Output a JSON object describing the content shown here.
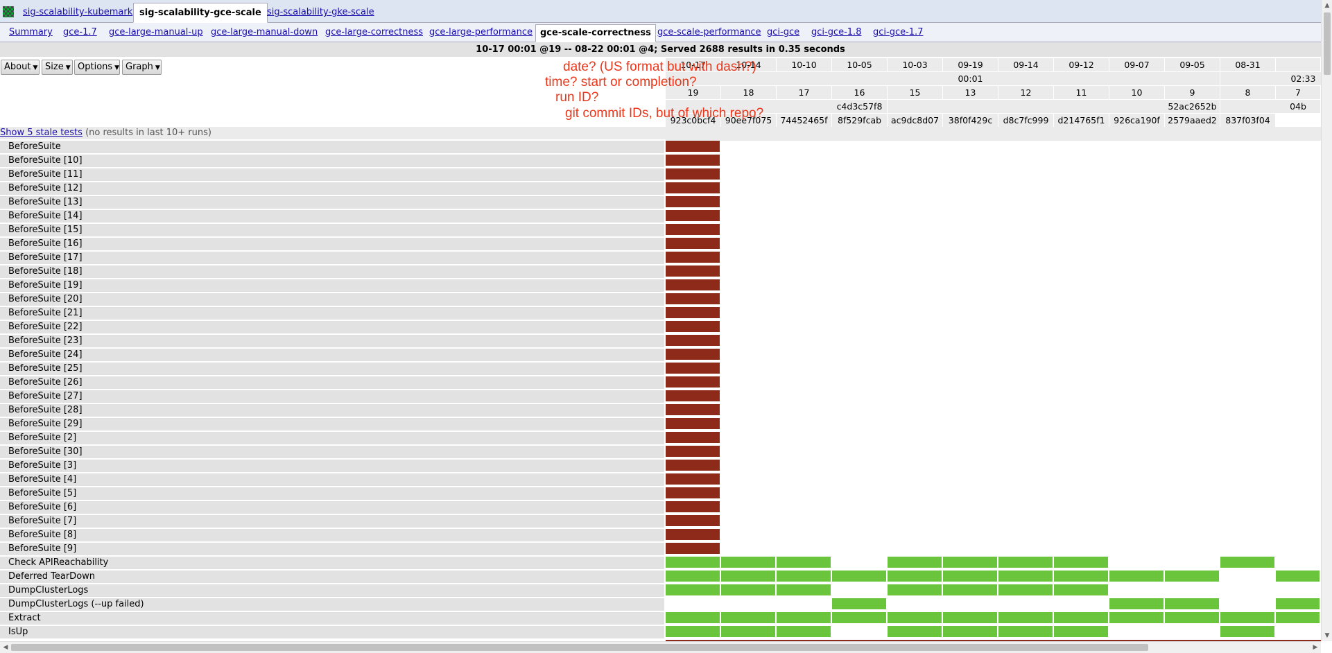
{
  "top_tabs": [
    {
      "label": "sig-scalability-kubemark",
      "active": false
    },
    {
      "label": "sig-scalability-gce-scale",
      "active": true
    },
    {
      "label": "sig-scalability-gke-scale",
      "active": false
    }
  ],
  "sub_tabs": [
    {
      "label": "Summary",
      "active": false
    },
    {
      "label": "gce-1.7",
      "active": false
    },
    {
      "label": "gce-large-manual-up",
      "active": false
    },
    {
      "label": "gce-large-manual-down",
      "active": false
    },
    {
      "label": "gce-large-correctness",
      "active": false
    },
    {
      "label": "gce-large-performance",
      "active": false
    },
    {
      "label": "gce-scale-correctness",
      "active": true
    },
    {
      "label": "gce-scale-performance",
      "active": false
    },
    {
      "label": "gci-gce",
      "active": false
    },
    {
      "label": "gci-gce-1.8",
      "active": false
    },
    {
      "label": "gci-gce-1.7",
      "active": false
    }
  ],
  "status": "10-17 00:01 @19 -- 08-22 00:01 @4; Served 2688 results in 0.35 seconds",
  "menu": {
    "about": "About",
    "size": "Size",
    "options": "Options",
    "graph": "Graph"
  },
  "columns": [
    {
      "date": "10-17",
      "run": "19",
      "commit2": "923c0bcf4"
    },
    {
      "date": "10-14",
      "run": "18",
      "commit2": "90ee7f075"
    },
    {
      "date": "10-10",
      "run": "17",
      "commit2": "74452465f"
    },
    {
      "date": "10-05",
      "run": "16",
      "commit1": "c4d3c57f8",
      "commit2": "8f529fcab"
    },
    {
      "date": "10-03",
      "run": "15",
      "commit2": "ac9dc8d07"
    },
    {
      "date": "09-19",
      "run": "13",
      "commit2": "38f0f429c"
    },
    {
      "date": "09-14",
      "run": "12",
      "commit2": "d8c7fc999"
    },
    {
      "date": "09-12",
      "run": "11",
      "commit2": "d214765f1"
    },
    {
      "date": "09-07",
      "run": "10",
      "commit2": "926ca190f"
    },
    {
      "date": "09-05",
      "run": "9",
      "commit1": "52ac2652b",
      "commit2": "2579aaed2"
    },
    {
      "date": "08-31",
      "run": "8",
      "commit2": "837f03f04"
    },
    {
      "date": "",
      "run": "7",
      "commit1": "04b"
    }
  ],
  "time_labels": {
    "group1": "00:01",
    "group2": "02:33"
  },
  "stale": {
    "link": "Show 5 stale tests",
    "note": "(no results in last 10+ runs)"
  },
  "legend_colors": {
    "fail": "#8e2a19",
    "pass": "#6ac43c",
    "none": "#ffffff"
  },
  "tests": [
    {
      "name": "BeforeSuite",
      "results": "F..........."
    },
    {
      "name": "BeforeSuite [10]",
      "results": "F..........."
    },
    {
      "name": "BeforeSuite [11]",
      "results": "F..........."
    },
    {
      "name": "BeforeSuite [12]",
      "results": "F..........."
    },
    {
      "name": "BeforeSuite [13]",
      "results": "F..........."
    },
    {
      "name": "BeforeSuite [14]",
      "results": "F..........."
    },
    {
      "name": "BeforeSuite [15]",
      "results": "F..........."
    },
    {
      "name": "BeforeSuite [16]",
      "results": "F..........."
    },
    {
      "name": "BeforeSuite [17]",
      "results": "F..........."
    },
    {
      "name": "BeforeSuite [18]",
      "results": "F..........."
    },
    {
      "name": "BeforeSuite [19]",
      "results": "F..........."
    },
    {
      "name": "BeforeSuite [20]",
      "results": "F..........."
    },
    {
      "name": "BeforeSuite [21]",
      "results": "F..........."
    },
    {
      "name": "BeforeSuite [22]",
      "results": "F..........."
    },
    {
      "name": "BeforeSuite [23]",
      "results": "F..........."
    },
    {
      "name": "BeforeSuite [24]",
      "results": "F..........."
    },
    {
      "name": "BeforeSuite [25]",
      "results": "F..........."
    },
    {
      "name": "BeforeSuite [26]",
      "results": "F..........."
    },
    {
      "name": "BeforeSuite [27]",
      "results": "F..........."
    },
    {
      "name": "BeforeSuite [28]",
      "results": "F..........."
    },
    {
      "name": "BeforeSuite [29]",
      "results": "F..........."
    },
    {
      "name": "BeforeSuite [2]",
      "results": "F..........."
    },
    {
      "name": "BeforeSuite [30]",
      "results": "F..........."
    },
    {
      "name": "BeforeSuite [3]",
      "results": "F..........."
    },
    {
      "name": "BeforeSuite [4]",
      "results": "F..........."
    },
    {
      "name": "BeforeSuite [5]",
      "results": "F..........."
    },
    {
      "name": "BeforeSuite [6]",
      "results": "F..........."
    },
    {
      "name": "BeforeSuite [7]",
      "results": "F..........."
    },
    {
      "name": "BeforeSuite [8]",
      "results": "F..........."
    },
    {
      "name": "BeforeSuite [9]",
      "results": "F..........."
    },
    {
      "name": "Check APIReachability",
      "results": "PPP.PPPP..P."
    },
    {
      "name": "Deferred TearDown",
      "results": "PPPPPPPPPP.P"
    },
    {
      "name": "DumpClusterLogs",
      "results": "PPP.PPPP...."
    },
    {
      "name": "DumpClusterLogs (--up failed)",
      "results": "...P....PP.P"
    },
    {
      "name": "Extract",
      "results": "PPPPPPPPPPPP"
    },
    {
      "name": "IsUp",
      "results": "PPP.PPPP..P."
    }
  ],
  "annotations": [
    "date? (US format but with dash?)",
    "time? start or completion?",
    "run ID?",
    "git commit IDs, but of which repo?"
  ]
}
